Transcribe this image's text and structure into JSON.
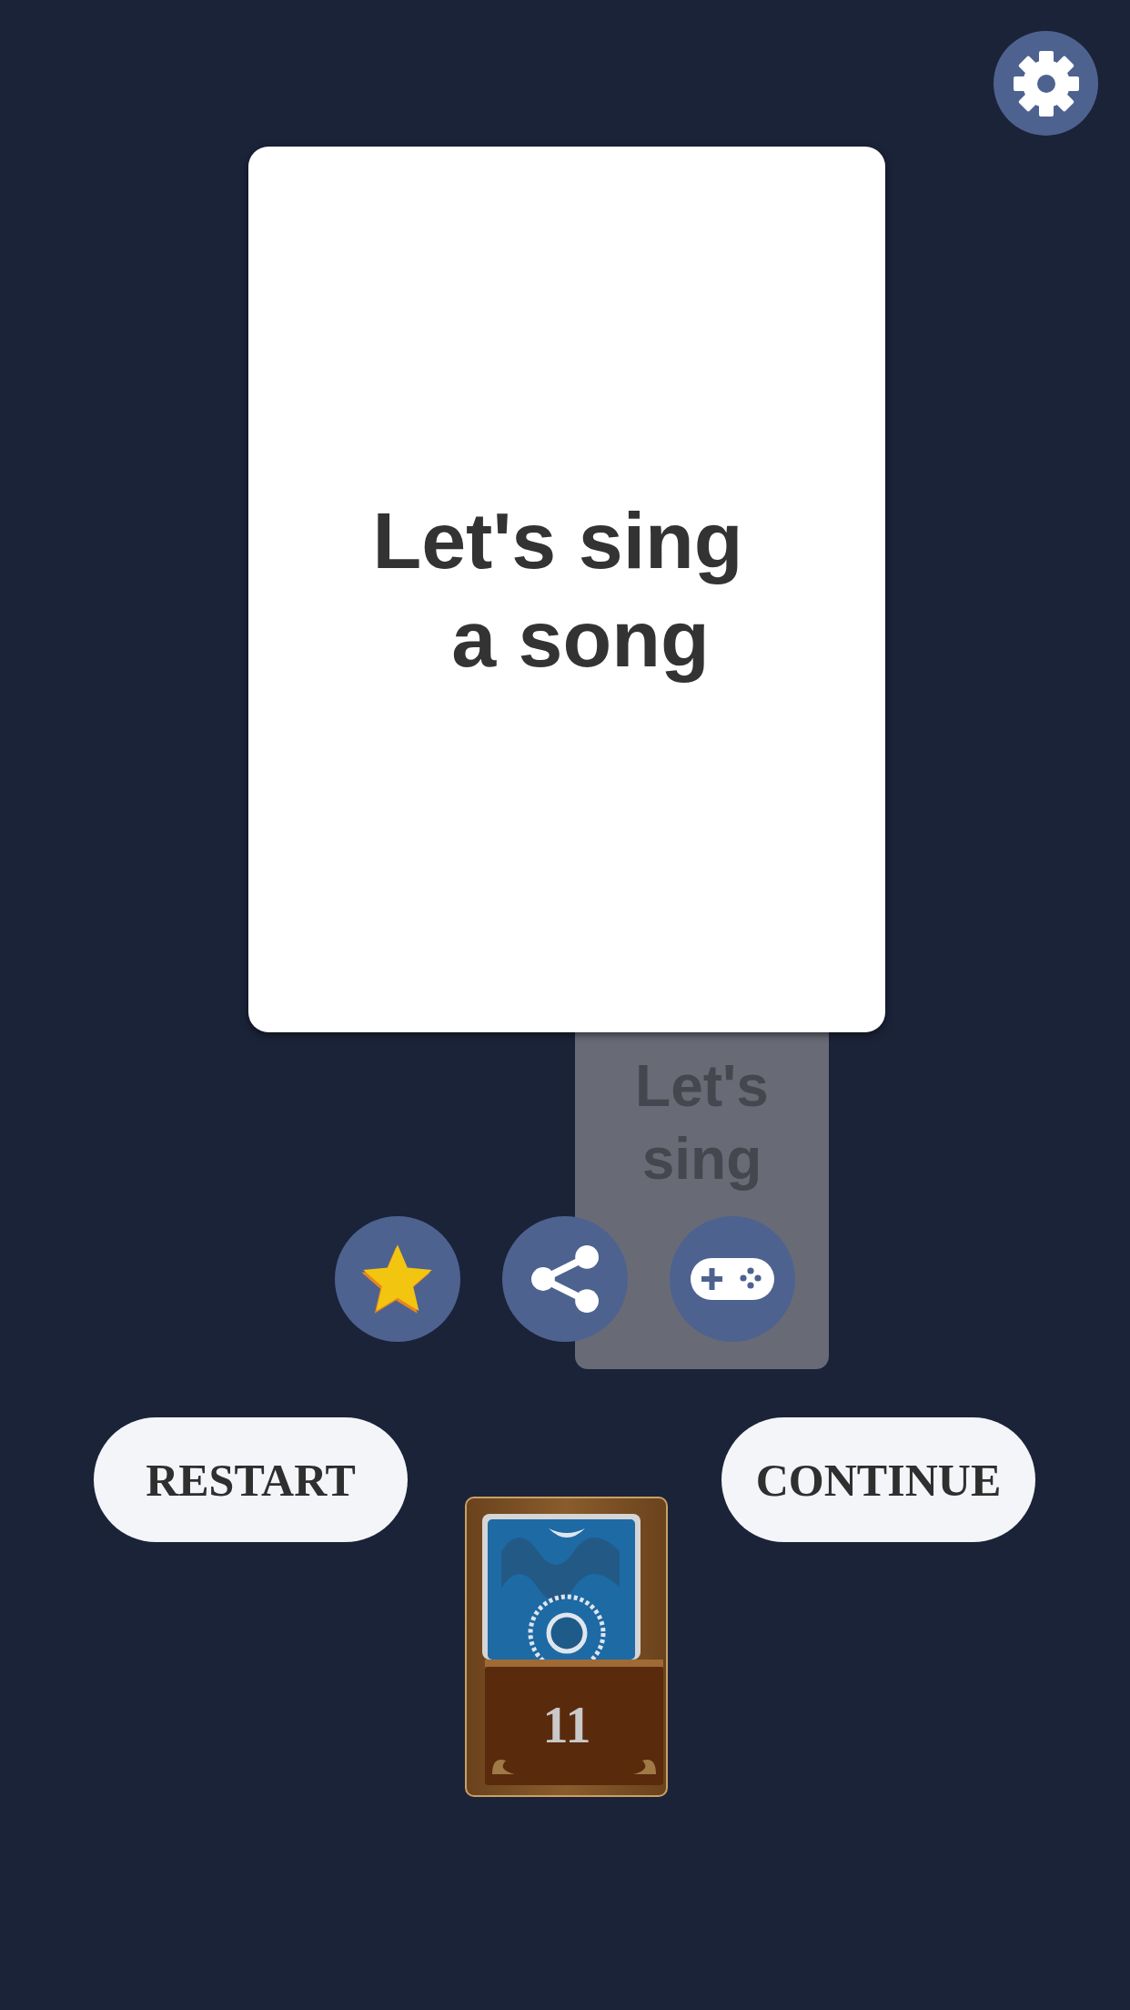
{
  "current_card": {
    "lines": [
      "Let's sing",
      "a song"
    ]
  },
  "next_card": {
    "lines": [
      "Let's",
      "sing"
    ]
  },
  "actions": [
    {
      "kind": "favorite"
    },
    {
      "kind": "share"
    },
    {
      "kind": "game"
    }
  ],
  "buttons": [
    {
      "label": "RESTART"
    },
    {
      "label": "CONTINUE"
    }
  ],
  "deck": {
    "count": "11"
  }
}
